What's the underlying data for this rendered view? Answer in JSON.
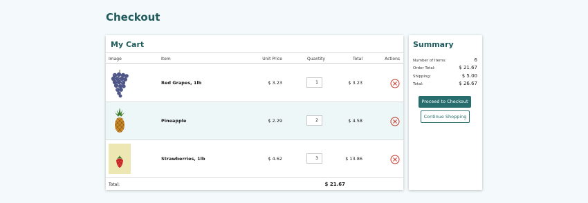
{
  "page": {
    "title": "Checkout"
  },
  "cart": {
    "title": "My Cart",
    "columns": {
      "image": "Image",
      "item": "Item",
      "unit_price": "Unit Price",
      "quantity": "Quantity",
      "total": "Total",
      "actions": "Actions"
    },
    "rows": [
      {
        "name": "Red Grapes, 1lb",
        "unit_price": "$ 3.23",
        "quantity": "1",
        "total": "$ 3.23",
        "image_icon": "grapes-image"
      },
      {
        "name": "Pineapple",
        "unit_price": "$ 2.29",
        "quantity": "2",
        "total": "$ 4.58",
        "image_icon": "pineapple-image"
      },
      {
        "name": "Strawberries, 1lb",
        "unit_price": "$ 4.62",
        "quantity": "3",
        "total": "$ 13.86",
        "image_icon": "strawberry-image"
      }
    ],
    "footer": {
      "label": "Total:",
      "total": "$ 21.67"
    }
  },
  "summary": {
    "title": "Summary",
    "items": [
      {
        "label": "Number of Items:",
        "value": "6"
      },
      {
        "label": "Order Total:",
        "value": "$ 21.67"
      },
      {
        "label": "Shipping:",
        "value": "$ 5.00"
      },
      {
        "label": "Total:",
        "value": "$ 26.67"
      }
    ],
    "checkout_label": "Proceed to Checkout",
    "continue_label": "Continue Shopping"
  },
  "colors": {
    "accent": "#276d6d",
    "title": "#1f5a5c",
    "remove": "#c0392b",
    "background": "#f4fafb",
    "alt_row": "#eef7f8"
  }
}
